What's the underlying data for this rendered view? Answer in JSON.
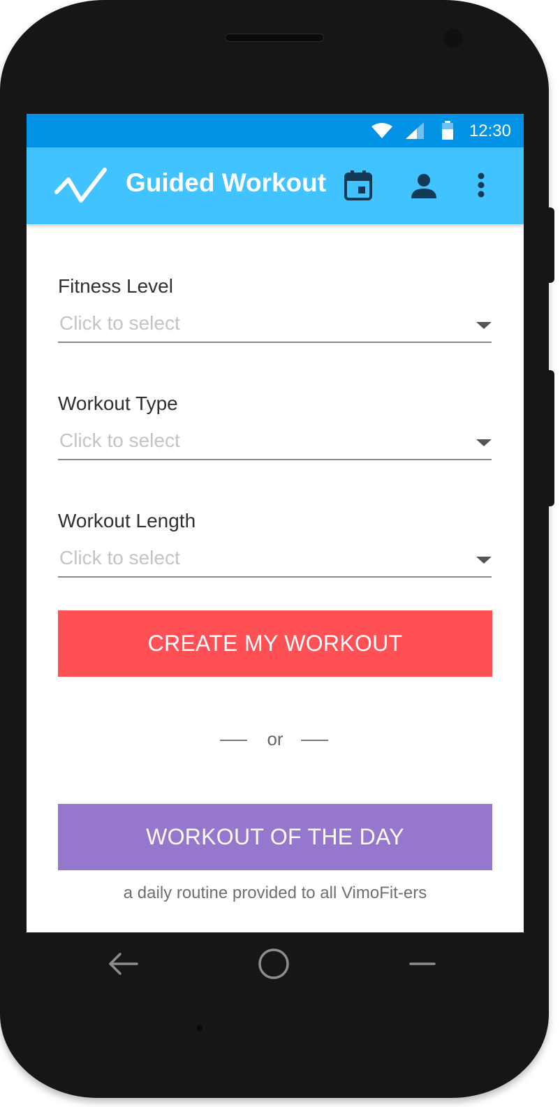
{
  "status_bar": {
    "time": "12:30",
    "icons": [
      "wifi-icon",
      "signal-icon",
      "battery-icon"
    ],
    "color": "#0293e6"
  },
  "app_bar": {
    "title": "Guided Workout",
    "color": "#40c3ff",
    "icons": [
      "logo-check-icon",
      "calendar-icon",
      "account-icon",
      "more-vert-icon"
    ]
  },
  "form": {
    "fields": [
      {
        "label": "Fitness Level",
        "placeholder": "Click to select"
      },
      {
        "label": "Workout Type",
        "placeholder": "Click to select"
      },
      {
        "label": "Workout Length",
        "placeholder": "Click to select"
      }
    ]
  },
  "actions": {
    "create_label": "CREATE MY WORKOUT",
    "create_color": "#ff5155",
    "or_text": "or",
    "wod_label": "WORKOUT OF THE DAY",
    "wod_color": "#9577cd",
    "wod_caption": "a daily routine provided to all VimoFit-ers"
  },
  "nav_bar": {
    "icons": [
      "back-icon",
      "home-icon",
      "recents-icon"
    ]
  }
}
